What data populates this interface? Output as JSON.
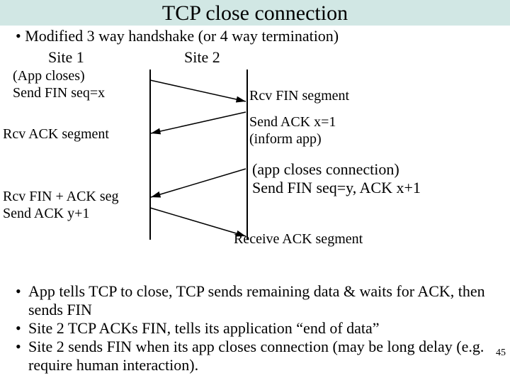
{
  "title": "TCP close connection",
  "subtitle": "Modified 3 way handshake (or 4 way termination)",
  "sites": {
    "s1": "Site 1",
    "s2": "Site 2"
  },
  "left": {
    "e1a": "(App closes)",
    "e1b": "Send FIN seq=x",
    "e2": "Rcv ACK segment",
    "e3a": "Rcv FIN + ACK seg",
    "e3b": "Send ACK y+1"
  },
  "right": {
    "e1": "Rcv FIN segment",
    "e2a": "Send ACK x=1",
    "e2b": "(inform app)",
    "e3a": "(app closes connection)",
    "e3b": "Send FIN seq=y, ACK x+1",
    "e4": "Receive ACK segment"
  },
  "bullets": {
    "b1": "App tells TCP to close, TCP sends remaining data & waits for ACK, then sends FIN",
    "b2": "Site 2 TCP ACKs FIN, tells its application  “end of data”",
    "b3": "Site 2 sends FIN when its app closes connection (may be long delay (e.g. require human interaction)."
  },
  "pagenum": "45",
  "bullet_glyph": "•"
}
